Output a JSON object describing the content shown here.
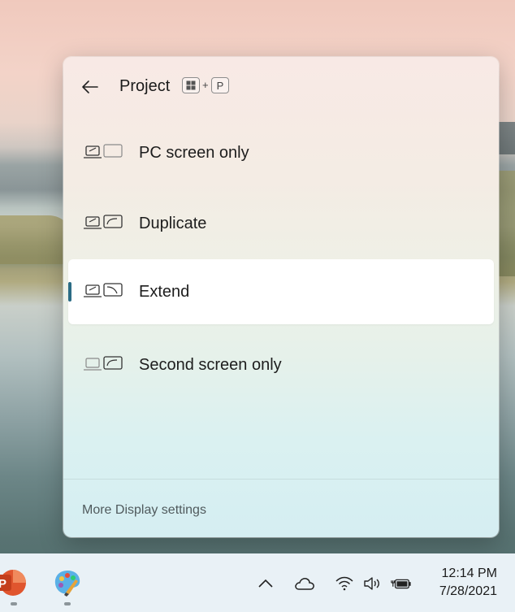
{
  "panel": {
    "title": "Project",
    "shortcut_key1": "win-logo",
    "shortcut_plus": "+",
    "shortcut_key2": "P",
    "options": [
      {
        "label": "PC screen only",
        "selected": false
      },
      {
        "label": "Duplicate",
        "selected": false
      },
      {
        "label": "Extend",
        "selected": true
      },
      {
        "label": "Second screen only",
        "selected": false
      }
    ],
    "footer_link": "More Display settings"
  },
  "taskbar": {
    "apps": [
      "powerpoint-icon",
      "paint-icon"
    ],
    "tray": [
      "chevron-up-icon",
      "onedrive-icon",
      "wifi-icon",
      "volume-icon",
      "battery-charging-icon"
    ],
    "time": "12:14 PM",
    "date": "7/28/2021"
  },
  "colors": {
    "accent": "#2b6c85",
    "selected_bg": "#ffffff",
    "taskbar_bg": "#e9f1f6"
  }
}
